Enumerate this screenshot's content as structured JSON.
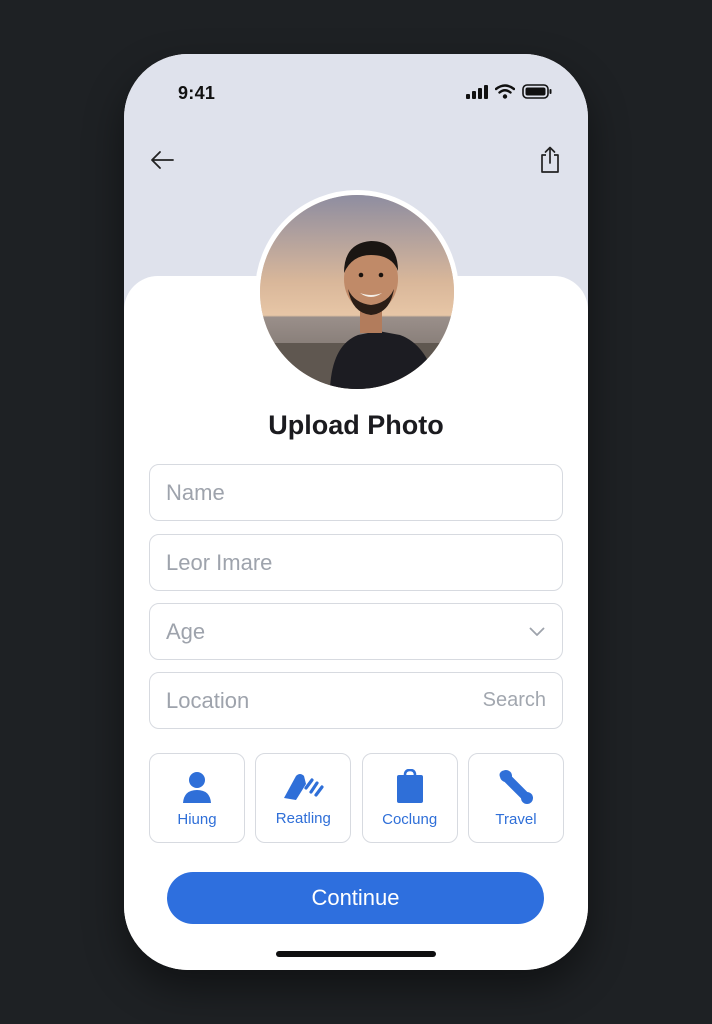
{
  "status_bar": {
    "time": "9:41",
    "icons": [
      "signal-icon",
      "wifi-icon",
      "battery-icon"
    ]
  },
  "header": {
    "back_icon": "arrow-left-icon",
    "share_icon": "share-icon"
  },
  "profile": {
    "avatar": "profile-photo",
    "title": "Upload Photo"
  },
  "form": {
    "name": {
      "placeholder": "Name",
      "value": ""
    },
    "last_name": {
      "placeholder": "Leor Imare",
      "value": ""
    },
    "age": {
      "placeholder": "Age",
      "value": "",
      "icon": "chevron-down-icon"
    },
    "location": {
      "placeholder": "Location",
      "value": "",
      "suffix": "Search"
    }
  },
  "interests": [
    {
      "label": "Hiung",
      "icon": "person-icon"
    },
    {
      "label": "Reatling",
      "icon": "hand-wave-icon"
    },
    {
      "label": "Coclung",
      "icon": "bag-icon"
    },
    {
      "label": "Travel",
      "icon": "travel-icon"
    }
  ],
  "actions": {
    "continue_label": "Continue"
  },
  "colors": {
    "accent": "#2e6fde",
    "header_bg": "#dfe2ec",
    "backdrop": "#1e2124"
  }
}
